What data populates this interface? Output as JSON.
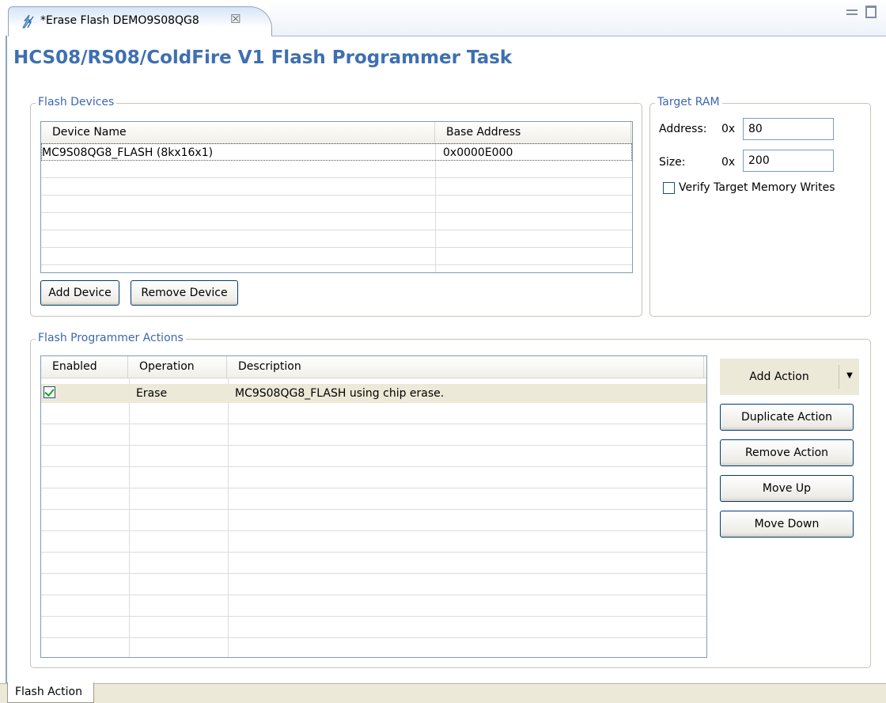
{
  "editor_tab": {
    "title": "*Erase Flash DEMO9S08QG8",
    "close_glyph": "☒",
    "icon": "flash-task-icon"
  },
  "page_title": "HCS08/RS08/ColdFire V1 Flash Programmer Task",
  "flash_devices": {
    "legend": "Flash Devices",
    "columns": [
      "Device Name",
      "Base Address"
    ],
    "rows": [
      {
        "device_name": "MC9S08QG8_FLASH (8kx16x1)",
        "base_address": "0x0000E000"
      }
    ],
    "add_button": "Add Device",
    "remove_button": "Remove Device"
  },
  "target_ram": {
    "legend": "Target RAM",
    "address_label": "Address:",
    "address_prefix": "0x",
    "address_value": "80",
    "size_label": "Size:",
    "size_prefix": "0x",
    "size_value": "200",
    "verify_label": "Verify Target Memory Writes",
    "verify_checked": false
  },
  "actions": {
    "legend": "Flash Programmer Actions",
    "columns": [
      "Enabled",
      "Operation",
      "Description"
    ],
    "rows": [
      {
        "enabled": true,
        "operation": "Erase",
        "description": "MC9S08QG8_FLASH using chip erase."
      }
    ],
    "add_action": "Add Action",
    "duplicate_action": "Duplicate Action",
    "remove_action": "Remove Action",
    "move_up": "Move Up",
    "move_down": "Move Down"
  },
  "bottom_tab": "Flash Action",
  "colors": {
    "title": "#3e6fb2",
    "legend": "#3c67ae",
    "selected_row": "#ece9d8"
  }
}
